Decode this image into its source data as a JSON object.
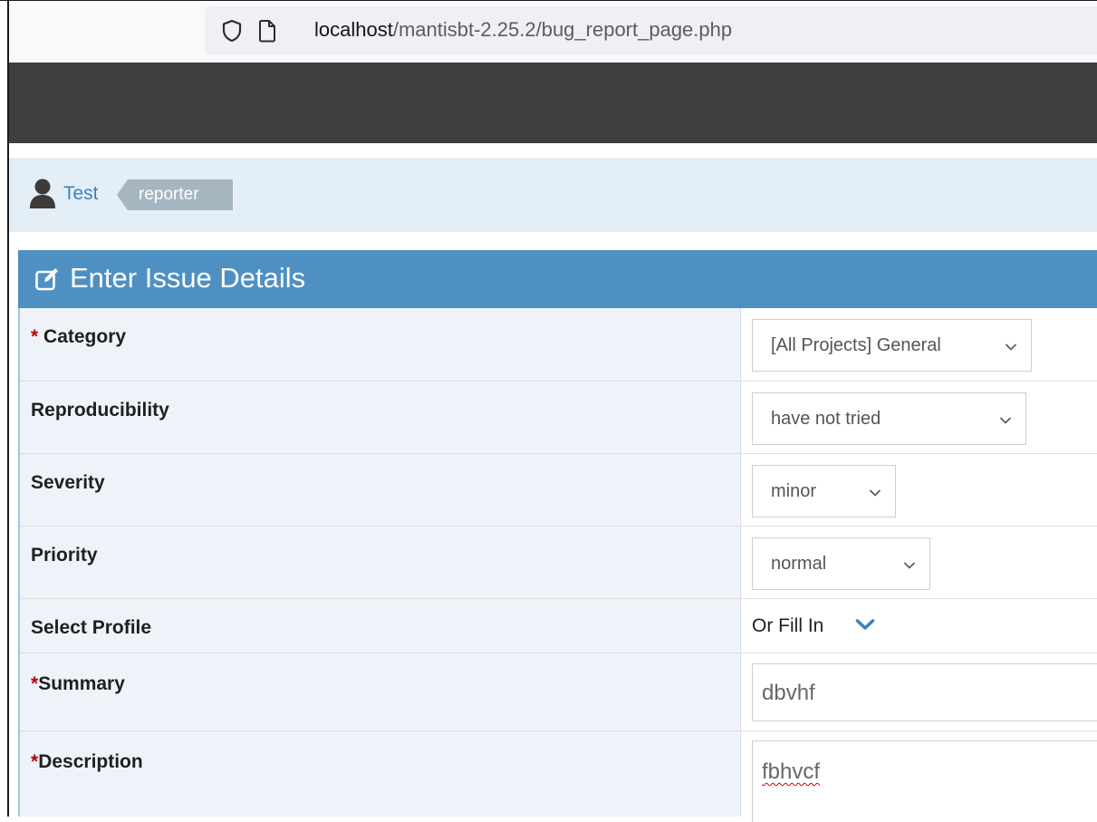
{
  "browser": {
    "url_host": "localhost",
    "url_path": "/mantisbt-2.25.2/bug_report_page.php",
    "icons": [
      "shield-icon",
      "page-icon"
    ]
  },
  "user_bar": {
    "username": "Test",
    "role": "reporter",
    "icon": "user-icon"
  },
  "widget": {
    "title": "Enter Issue Details",
    "icon": "edit-icon",
    "header_color": "#4f90c2"
  },
  "form": {
    "category": {
      "required_mark": "*",
      "label": "Category",
      "value": "[All Projects] General"
    },
    "reproducibility": {
      "label": "Reproducibility",
      "value": "have not tried"
    },
    "severity": {
      "label": "Severity",
      "value": "minor"
    },
    "priority": {
      "label": "Priority",
      "value": "normal"
    },
    "profile": {
      "label": "Select Profile",
      "link": "Or Fill In"
    },
    "summary": {
      "required_mark": "*",
      "label": "Summary",
      "value": "dbvhf"
    },
    "description": {
      "required_mark": "*",
      "label": "Description",
      "value": "fbhvcf"
    }
  }
}
